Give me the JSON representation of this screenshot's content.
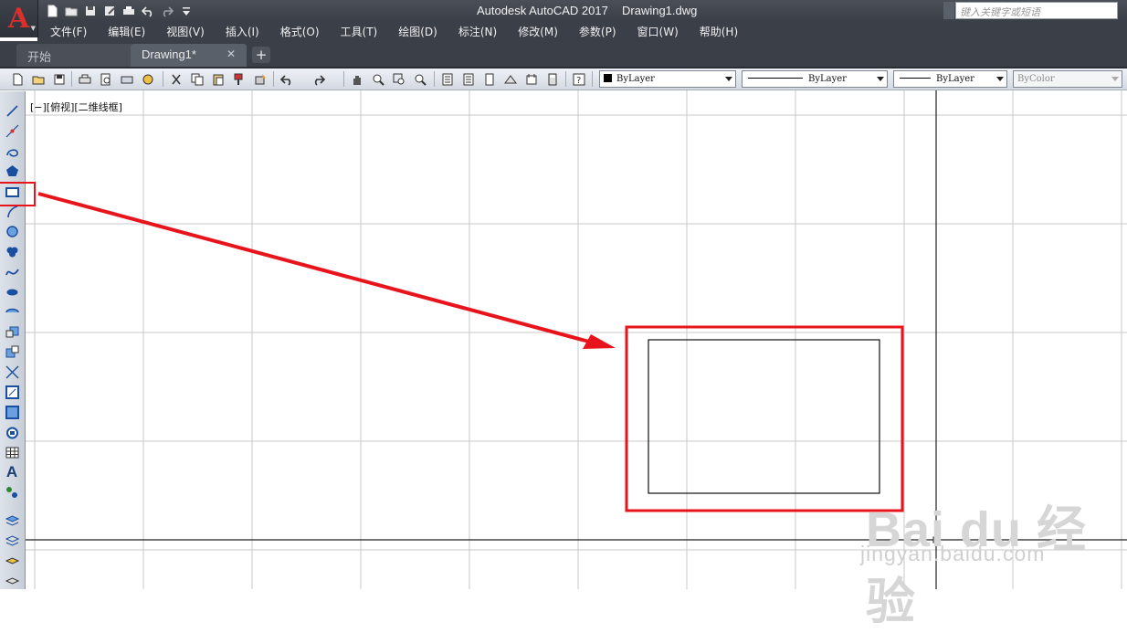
{
  "app": {
    "logo_letter": "A",
    "title": "Autodesk AutoCAD 2017",
    "document": "Drawing1.dwg",
    "search_placeholder": "键入关键字或短语"
  },
  "quick_access": [
    "new-icon",
    "open-icon",
    "save-icon",
    "saveas-icon",
    "print-icon",
    "undo-icon",
    "redo-icon",
    "customize-icon"
  ],
  "menu": [
    "文件(F)",
    "编辑(E)",
    "视图(V)",
    "插入(I)",
    "格式(O)",
    "工具(T)",
    "绘图(D)",
    "标注(N)",
    "修改(M)",
    "参数(P)",
    "窗口(W)",
    "帮助(H)"
  ],
  "tabs": {
    "start": "开始",
    "drawing": "Drawing1*",
    "close": "✕",
    "add": "+"
  },
  "toolbar": {
    "layer_combo": "ByLayer",
    "linetype_combo": "ByLayer",
    "lineweight_combo": "ByLayer",
    "color_combo": "ByColor"
  },
  "viewport": {
    "label": "[−][俯视][二维线框]"
  },
  "left_tools": [
    "line-icon",
    "construction-line-icon",
    "polyline-icon",
    "polygon-icon",
    "rectangle-icon",
    "arc-icon",
    "circle-icon",
    "revision-cloud-icon",
    "spline-icon",
    "ellipse-icon",
    "ellipse-arc-icon",
    "insert-block-icon",
    "make-block-icon",
    "point-icon",
    "hatch-icon",
    "gradient-icon",
    "region-icon",
    "table-icon",
    "multiline-text-icon",
    "add-selected-icon",
    "layer-icon",
    "layer-states-icon",
    "layer-previous-icon",
    "layer-isolate-icon"
  ],
  "left_text_tool": "A",
  "watermark": {
    "logo": "Bai du 经验",
    "url": "jingyan.baidu.com"
  },
  "colors": {
    "highlight_red": "#e8141b",
    "dark_chrome": "#3b3f47"
  }
}
